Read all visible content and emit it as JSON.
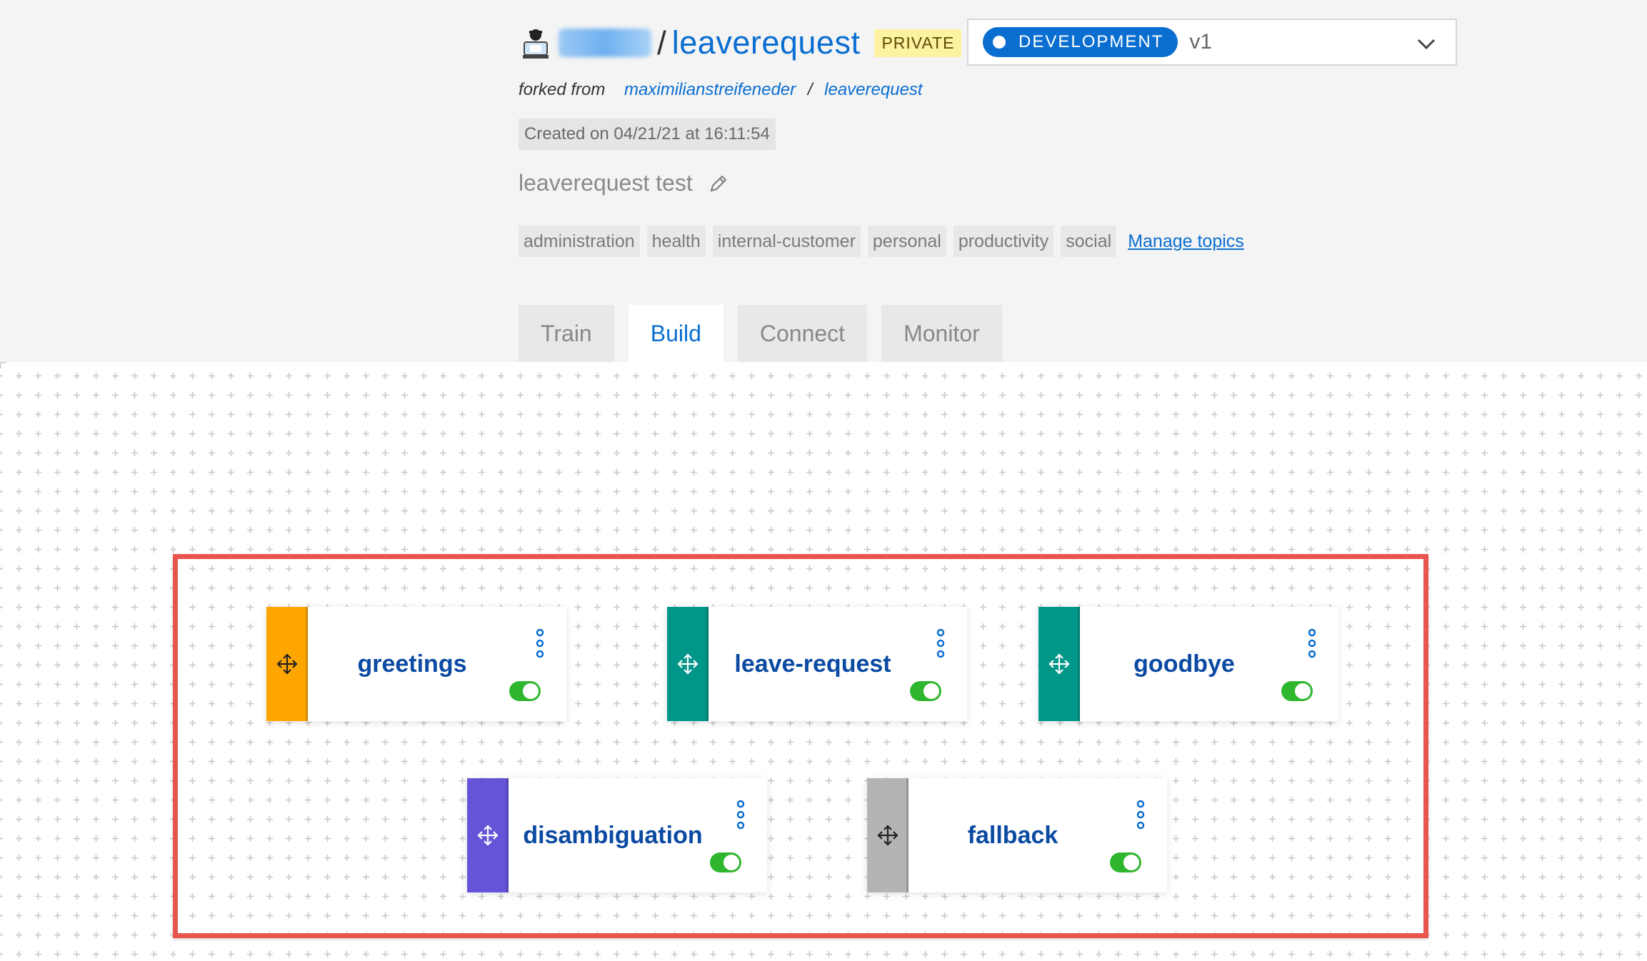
{
  "header": {
    "owner_redacted": "",
    "slash": "/",
    "repo_name": "leaverequest",
    "visibility_badge": "PRIVATE",
    "environment": {
      "label": "DEVELOPMENT",
      "version": "v1"
    },
    "forked_from": {
      "prefix": "forked from",
      "owner": "maximilianstreifeneder",
      "separator": "/",
      "repo": "leaverequest"
    },
    "created": "Created on 04/21/21 at 16:11:54",
    "description": "leaverequest test",
    "topics": [
      "administration",
      "health",
      "internal-customer",
      "personal",
      "productivity",
      "social"
    ],
    "manage_topics": "Manage topics"
  },
  "tabs": [
    {
      "label": "Train",
      "active": false
    },
    {
      "label": "Build",
      "active": true
    },
    {
      "label": "Connect",
      "active": false
    },
    {
      "label": "Monitor",
      "active": false
    }
  ],
  "skills": [
    {
      "name": "greetings",
      "color": "#ffa500",
      "handle_icon": "move-icon",
      "enabled": true
    },
    {
      "name": "leave-request",
      "color": "#009688",
      "handle_icon": "move-icon",
      "enabled": true
    },
    {
      "name": "goodbye",
      "color": "#009688",
      "handle_icon": "move-icon",
      "enabled": true
    },
    {
      "name": "disambiguation",
      "color": "#6554d8",
      "handle_icon": "move-icon",
      "enabled": true
    },
    {
      "name": "fallback",
      "color": "#b4b4b4",
      "handle_icon": "move-icon",
      "enabled": true
    }
  ],
  "colors": {
    "accent": "#0a6ed1",
    "highlight_border": "#e8554d",
    "toggle_on": "#2fb62f"
  }
}
